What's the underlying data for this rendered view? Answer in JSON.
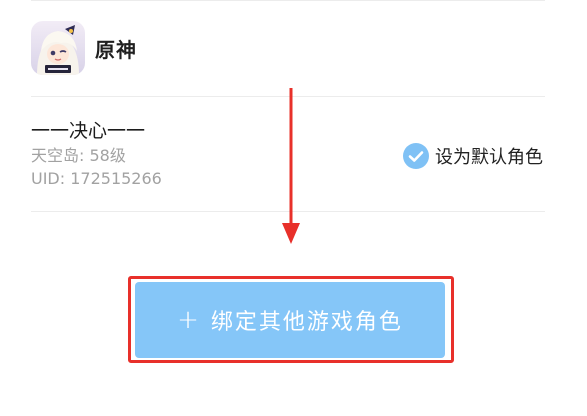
{
  "game": {
    "icon": "genshin-app-icon",
    "name": "原神"
  },
  "character": {
    "name": "一一决心一一",
    "server": "天空岛: 58级",
    "uid": "UID: 172515266"
  },
  "default_role": {
    "checked": true,
    "icon": "check-circle-icon",
    "label": "设为默认角色"
  },
  "bind_button": {
    "plus": "+",
    "label": "绑定其他游戏角色"
  },
  "colors": {
    "accent": "#85c6f8",
    "check": "#7fc1f5",
    "highlight": "#e8302a",
    "secondary_text": "#a2a2a2"
  }
}
